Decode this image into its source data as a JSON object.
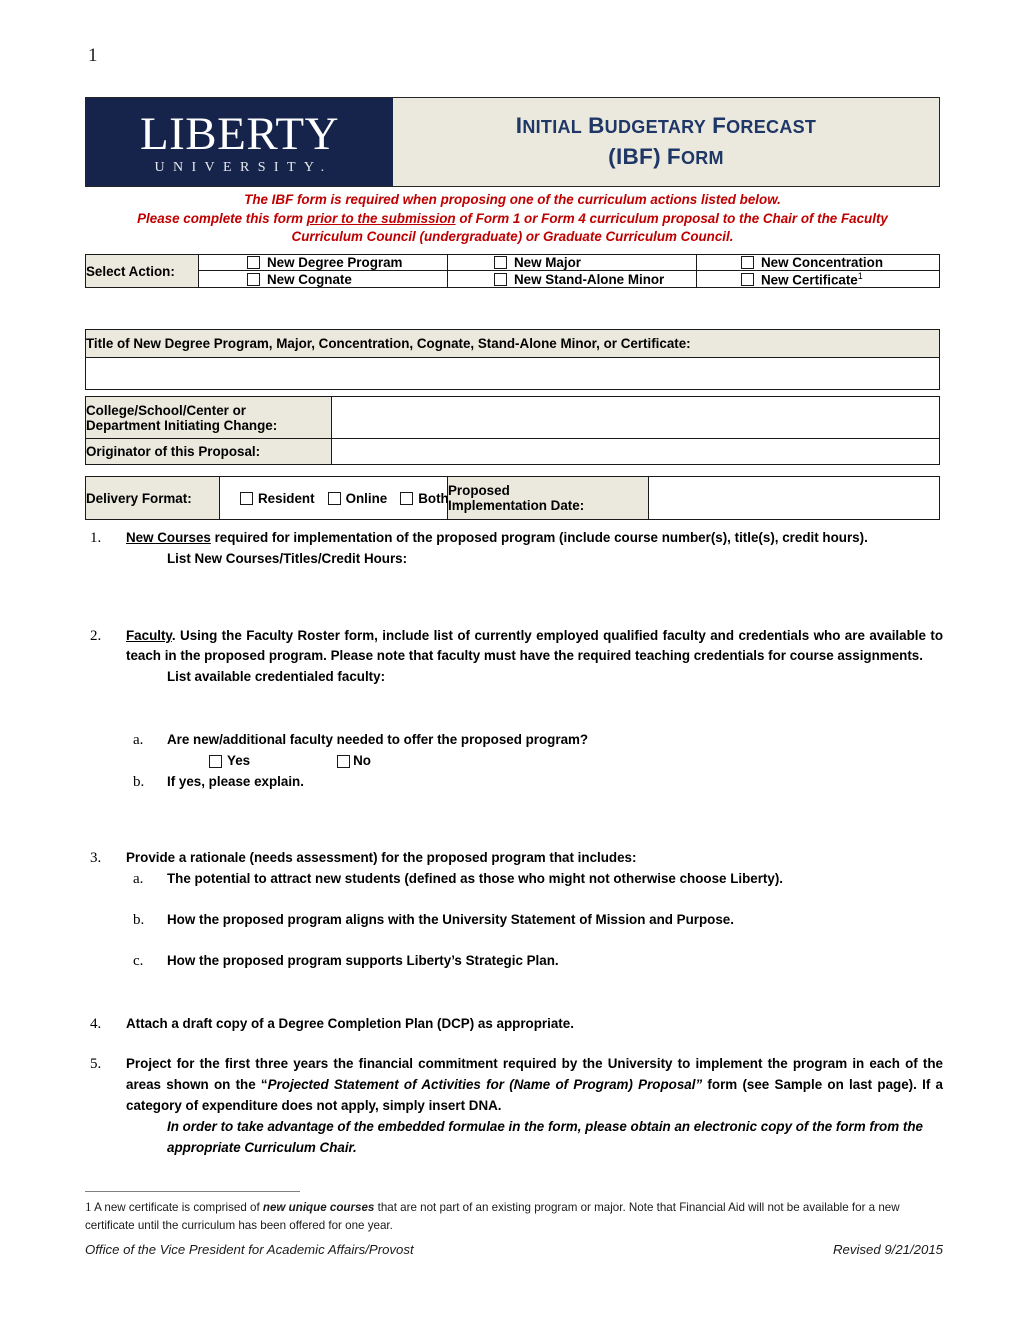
{
  "page": {
    "number": "1"
  },
  "header": {
    "logo_wordmark": "LIBERTY",
    "logo_subtext": "UNIVERSITY.",
    "title_line1_part1": "I",
    "title_line1_part2": "NITIAL",
    "title_line1_part3": "B",
    "title_line1_part4": "UDGETARY",
    "title_line1_part5": "F",
    "title_line1_part6": "ORECAST",
    "title_line2_part1": "(IBF)",
    "title_line2_part2": "F",
    "title_line2_part3": "ORM",
    "navy": "#16244c",
    "cream": "#ebe9de",
    "title_color": "#1f3766"
  },
  "instructions": {
    "line1": "The IBF form is required when proposing one of the curriculum actions listed below.",
    "line2_before": "Please complete this form ",
    "line2_underlined": "prior to the submission",
    "line2_after": " of Form 1 or Form 4 curriculum proposal to the Chair of the Faculty",
    "line3": "Curriculum Council (undergraduate) or Graduate Curriculum Council.",
    "color": "#c00000"
  },
  "select_action": {
    "label": "Select Action:",
    "options": [
      "New Degree Program",
      "New Major",
      "New Concentration",
      "New Cognate",
      "New Stand-Alone Minor",
      "New Certificate"
    ],
    "certificate_footnote_marker": "1"
  },
  "title_field": {
    "label": "Title of New Degree Program, Major, Concentration, Cognate,  Stand-Alone Minor, or Certificate:",
    "value": ""
  },
  "origin_fields": {
    "college_label_line1": "College/School/Center or",
    "college_label_line2": "Department Initiating Change:",
    "college_value": "",
    "originator_label": "Originator of this Proposal:",
    "originator_value": ""
  },
  "delivery": {
    "label": "Delivery Format:",
    "options": [
      "Resident",
      "Online",
      "Both"
    ],
    "date_label_line1": "Proposed",
    "date_label_line2": "Implementation Date:",
    "date_value": ""
  },
  "items": {
    "one": {
      "marker": "1.",
      "underlined": "New Courses",
      "rest": " required for implementation of the proposed program (include course number(s), title(s), credit hours).",
      "sub": "List New Courses/Titles/Credit Hours:"
    },
    "two": {
      "marker": "2.",
      "underlined": "Faculty",
      "rest": ".  Using the Faculty Roster form, include list of currently employed qualified faculty and credentials who are available to teach in the proposed program. Please note that faculty must have the required teaching credentials for course assignments.",
      "sub": "List available credentialed faculty:",
      "a_marker": "a.",
      "a_text": "Are new/additional faculty needed to offer the proposed program?",
      "yes_label": "Yes",
      "no_label": "No",
      "b_marker": "b.",
      "b_text": "If yes, please explain."
    },
    "three": {
      "marker": "3.",
      "text": "Provide a rationale (needs assessment) for the proposed program that includes:",
      "a_marker": "a.",
      "a_text": "The potential to attract new students (defined as those who might not otherwise choose Liberty).",
      "b_marker": "b.",
      "b_text": "How the proposed program aligns with the University Statement of Mission and Purpose.",
      "c_marker": "c.",
      "c_text": "How the proposed program supports Liberty’s Strategic Plan."
    },
    "four": {
      "marker": "4.",
      "text": "Attach a draft copy of a Degree Completion Plan (DCP) as appropriate."
    },
    "five": {
      "marker": "5.",
      "text_part1": "Project for the first three years the financial commitment required by the University to implement the program in each of the areas shown on the “",
      "italic_phrase": "Projected Statement of Activities for (Name of Program) Proposal”",
      "text_part2": " form (see Sample on last page).  If a category of expenditure does not apply, simply insert DNA.",
      "note": "In order to take advantage of the embedded formulae in the form, please obtain an electronic copy of the form from the appropriate Curriculum Chair."
    }
  },
  "footnote": {
    "marker": "1",
    "part1": " A new certificate is comprised of ",
    "bold_phrase": "new unique courses",
    "part2": " that are not part of an existing program or major.  Note that Financial Aid will not be available for a new certificate until the curriculum has been offered for one year."
  },
  "footer": {
    "left": "Office of the Vice President for Academic Affairs/Provost",
    "right": "Revised 9/21/2015"
  }
}
